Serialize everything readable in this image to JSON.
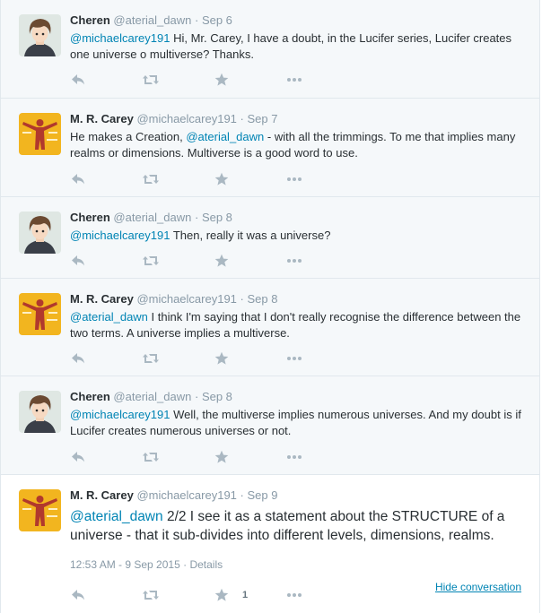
{
  "tweets": [
    {
      "fullname": "Cheren",
      "username": "@aterial_dawn",
      "separator": "·",
      "time": "Sep 6",
      "segments": [
        {
          "text": "@michaelcarey191",
          "mention": true
        },
        {
          "text": " Hi, Mr. Carey, I have a doubt, in the Lucifer series, Lucifer creates one universe o multiverse? Thanks.",
          "mention": false
        }
      ],
      "avatar": "cheren"
    },
    {
      "fullname": "M. R. Carey",
      "username": "@michaelcarey191",
      "separator": "·",
      "time": "Sep 7",
      "segments": [
        {
          "text": "He makes a Creation, ",
          "mention": false
        },
        {
          "text": "@aterial_dawn",
          "mention": true
        },
        {
          "text": " - with all the trimmings. To me that implies many realms or dimensions. Multiverse is a good word to use.",
          "mention": false
        }
      ],
      "avatar": "carey"
    },
    {
      "fullname": "Cheren",
      "username": "@aterial_dawn",
      "separator": "·",
      "time": "Sep 8",
      "segments": [
        {
          "text": "@michaelcarey191",
          "mention": true
        },
        {
          "text": " Then, really it was a universe?",
          "mention": false
        }
      ],
      "avatar": "cheren"
    },
    {
      "fullname": "M. R. Carey",
      "username": "@michaelcarey191",
      "separator": "·",
      "time": "Sep 8",
      "segments": [
        {
          "text": "@aterial_dawn",
          "mention": true
        },
        {
          "text": " I think I'm saying that I don't really recognise the difference between the two terms. A universe implies a multiverse.",
          "mention": false
        }
      ],
      "avatar": "carey"
    },
    {
      "fullname": "Cheren",
      "username": "@aterial_dawn",
      "separator": "·",
      "time": "Sep 8",
      "segments": [
        {
          "text": "@michaelcarey191",
          "mention": true
        },
        {
          "text": " Well,  the multiverse implies numerous universes. And my doubt is if Lucifer creates numerous universes or not.",
          "mention": false
        }
      ],
      "avatar": "cheren"
    },
    {
      "fullname": "M. R. Carey",
      "username": "@michaelcarey191",
      "separator": "·",
      "time": "Sep 9",
      "segments": [
        {
          "text": "@aterial_dawn",
          "mention": true
        },
        {
          "text": " 2/2 I see it as a statement about the STRUCTURE of a universe - that it sub-divides into different levels, dimensions, realms.",
          "mention": false
        }
      ],
      "avatar": "carey",
      "timestamp": "12:53 AM - 9 Sep 2015",
      "details_label": "Details",
      "favorite_count": "1",
      "hide_conversation_label": "Hide conversation"
    }
  ],
  "action_icons": [
    "reply-icon",
    "retweet-icon",
    "favorite-icon",
    "more-icon"
  ],
  "colors": {
    "mention": "#0084b4",
    "name": "#292f33",
    "muted": "#8899a6",
    "icon": "#aab8c2",
    "reply_bg": "#f5f8fa",
    "focus_bg": "#ffffff",
    "border": "#e1e8ed"
  }
}
